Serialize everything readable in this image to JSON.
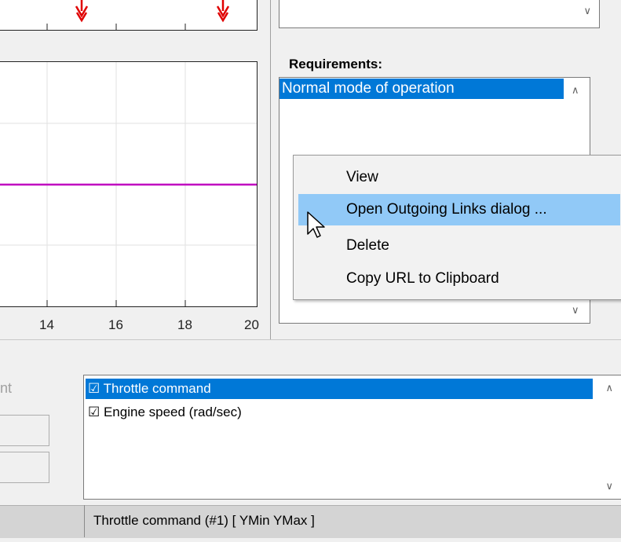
{
  "requirements": {
    "label": "Requirements:",
    "items": [
      "Normal mode of operation"
    ]
  },
  "context_menu": {
    "items": [
      "View",
      "Open Outgoing Links dialog ...",
      "Delete",
      "Copy URL to Clipboard"
    ],
    "highlighted": "Open Outgoing Links dialog ..."
  },
  "plot": {
    "x_ticks": [
      "14",
      "16",
      "18",
      "20"
    ],
    "line_color": "#c000c0",
    "marker_color": "#e00000"
  },
  "left_panel": {
    "partial_label": "nt"
  },
  "signals": {
    "items": [
      {
        "label": "☑ Throttle command",
        "selected": true
      },
      {
        "label": "☑ Engine speed (rad/sec)",
        "selected": false
      }
    ]
  },
  "status": {
    "text": "Throttle command (#1)  [ YMin YMax ]"
  },
  "colors": {
    "selection": "#0078d7",
    "menu_highlight": "#91c9f7"
  }
}
